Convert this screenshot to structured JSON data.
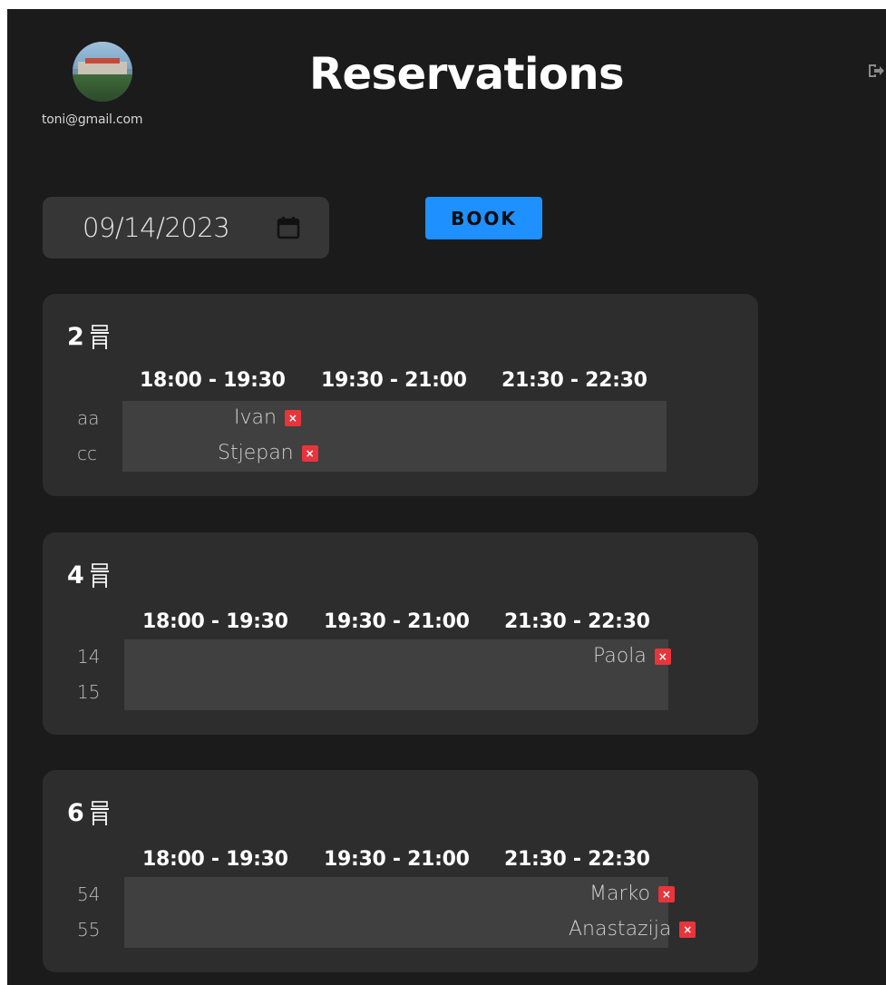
{
  "user": {
    "email": "toni@gmail.com"
  },
  "header": {
    "title": "Reservations"
  },
  "controls": {
    "date_value": "09/14/2023",
    "book_label": "BOOK"
  },
  "icons": {
    "logout": "sign-out-icon",
    "calendar": "calendar-icon",
    "table": "table-icon",
    "delete": "delete-icon"
  },
  "colors": {
    "background": "#1b1b1b",
    "card": "#2d2d2d",
    "accent": "#1e90ff",
    "delete": "#e8343b"
  },
  "slots": [
    "18:00 - 19:30",
    "19:30 - 21:00",
    "21:30 - 22:30"
  ],
  "tables": [
    {
      "size": "2",
      "rows": [
        {
          "label": "aa",
          "reservations": [
            {
              "slot": 0,
              "name": "Ivan",
              "delete_label": "×"
            }
          ]
        },
        {
          "label": "cc",
          "reservations": [
            {
              "slot": 0,
              "name": "Stjepan",
              "delete_label": "×"
            }
          ]
        }
      ]
    },
    {
      "size": "4",
      "rows": [
        {
          "label": "14",
          "reservations": [
            {
              "slot": 2,
              "name": "Paola",
              "delete_label": "×"
            }
          ]
        },
        {
          "label": "15",
          "reservations": []
        }
      ]
    },
    {
      "size": "6",
      "rows": [
        {
          "label": "54",
          "reservations": [
            {
              "slot": 2,
              "name": "Marko",
              "delete_label": "×"
            }
          ]
        },
        {
          "label": "55",
          "reservations": [
            {
              "slot": 2,
              "name": "Anastazija",
              "delete_label": "×"
            }
          ]
        }
      ]
    }
  ]
}
